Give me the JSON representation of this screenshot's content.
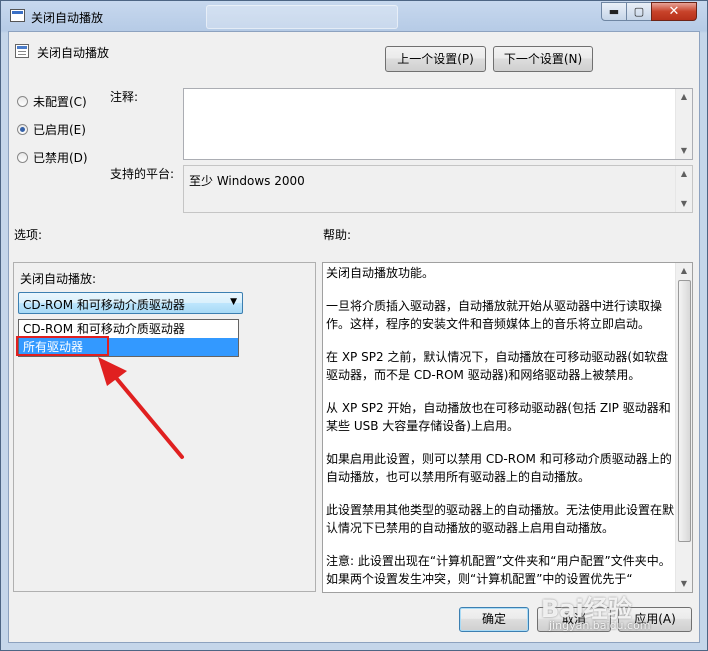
{
  "window": {
    "title": "关闭自动播放"
  },
  "header": {
    "policy_name": "关闭自动播放",
    "prev_button": "上一个设置(P)",
    "next_button": "下一个设置(N)"
  },
  "state": {
    "options": [
      {
        "label": "未配置(C)",
        "selected": false
      },
      {
        "label": "已启用(E)",
        "selected": true
      },
      {
        "label": "已禁用(D)",
        "selected": false
      }
    ]
  },
  "comment": {
    "label": "注释:",
    "value": ""
  },
  "platform": {
    "label": "支持的平台:",
    "value": "至少 Windows 2000"
  },
  "options_section": {
    "label": "选项:",
    "field_label": "关闭自动播放:",
    "combo_value": "CD-ROM 和可移动介质驱动器",
    "dropdown_items": [
      "CD-ROM 和可移动介质驱动器",
      "所有驱动器"
    ],
    "highlighted_item": "所有驱动器"
  },
  "help_section": {
    "label": "帮助:",
    "paragraphs": [
      "关闭自动播放功能。",
      "一旦将介质插入驱动器，自动播放就开始从驱动器中进行读取操作。这样，程序的安装文件和音频媒体上的音乐将立即启动。",
      "在 XP SP2 之前，默认情况下，自动播放在可移动驱动器(如软盘驱动器，而不是 CD-ROM 驱动器)和网络驱动器上被禁用。",
      "从 XP SP2 开始，自动播放也在可移动驱动器(包括 ZIP 驱动器和某些 USB 大容量存储设备)上启用。",
      "如果启用此设置，则可以禁用 CD-ROM 和可移动介质驱动器上的自动播放，也可以禁用所有驱动器上的自动播放。",
      "此设置禁用其他类型的驱动器上的自动播放。无法使用此设置在默认情况下已禁用的自动播放的驱动器上启用自动播放。",
      "注意: 此设置出现在“计算机配置”文件夹和“用户配置”文件夹中。如果两个设置发生冲突，则“计算机配置”中的设置优先于“"
    ]
  },
  "footer": {
    "ok_button": "确定",
    "cancel_button": "取消",
    "apply_button": "应用(A)"
  },
  "watermark": {
    "text": "Bai经验",
    "url": "jingyan.baidu.com"
  },
  "annotation": {
    "color": "#e02020"
  }
}
